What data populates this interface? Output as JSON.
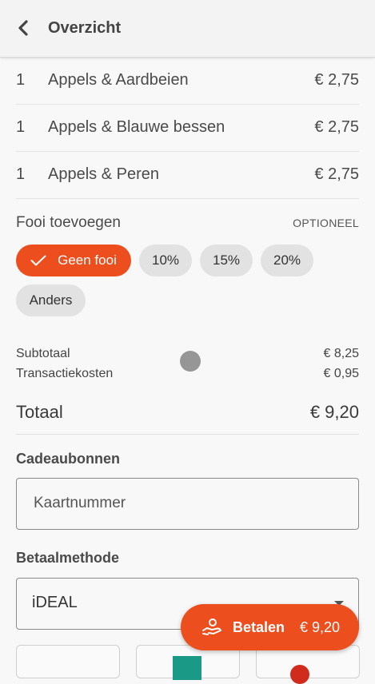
{
  "header": {
    "title": "Overzicht"
  },
  "items": [
    {
      "qty": "1",
      "name": "Appels & Aardbeien",
      "price": "€ 2,75"
    },
    {
      "qty": "1",
      "name": "Appels & Blauwe bessen",
      "price": "€ 2,75"
    },
    {
      "qty": "1",
      "name": "Appels & Peren",
      "price": "€ 2,75"
    }
  ],
  "tip": {
    "title": "Fooi toevoegen",
    "optional": "OPTIONEEL",
    "options": [
      "Geen fooi",
      "10%",
      "15%",
      "20%",
      "Anders"
    ],
    "selected": "Geen fooi"
  },
  "summary": {
    "subtotal_label": "Subtotaal",
    "subtotal_value": "€ 8,25",
    "fee_label": "Transactiekosten",
    "fee_value": "€ 0,95",
    "total_label": "Totaal",
    "total_value": "€ 9,20"
  },
  "gift": {
    "title": "Cadeaubonnen",
    "placeholder": "Kaartnummer"
  },
  "payment": {
    "title": "Betaalmethode",
    "selected": "iDEAL"
  },
  "pay_button": {
    "label": "Betalen",
    "amount": "€ 9,20"
  },
  "colors": {
    "accent": "#ec4e1d",
    "chip_bg": "#e2e2e2",
    "background": "#f8f8f8"
  }
}
